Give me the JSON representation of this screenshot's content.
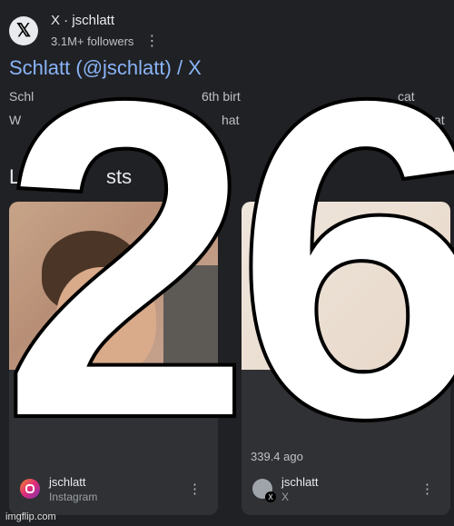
{
  "header": {
    "site_line": "X · jschlatt",
    "followers": "3.1M+ followers",
    "logo_glyph": "𝕏"
  },
  "result": {
    "title": "Schlatt (@jschlatt) / X",
    "snippet_line1_left": "Schl",
    "snippet_line1_mid": "6th birt",
    "snippet_line1_right": "cat",
    "snippet_line2_left": "W",
    "snippet_line2_mid": "hat",
    "snippet_line2_right": "at"
  },
  "section": {
    "label_left": "L",
    "label_mid": "sts"
  },
  "cards": [
    {
      "source_name": "jschlatt",
      "source_site": "Instagram",
      "icon": "instagram-icon"
    },
    {
      "meta": "339.4 ago",
      "source_name": "jschlatt",
      "source_site": "X",
      "icon": "x-avatar-icon"
    }
  ],
  "overlay": {
    "number": "26"
  },
  "watermark": "imgflip.com",
  "colors": {
    "background": "#202124",
    "link": "#8ab4f8",
    "card": "#303134"
  }
}
